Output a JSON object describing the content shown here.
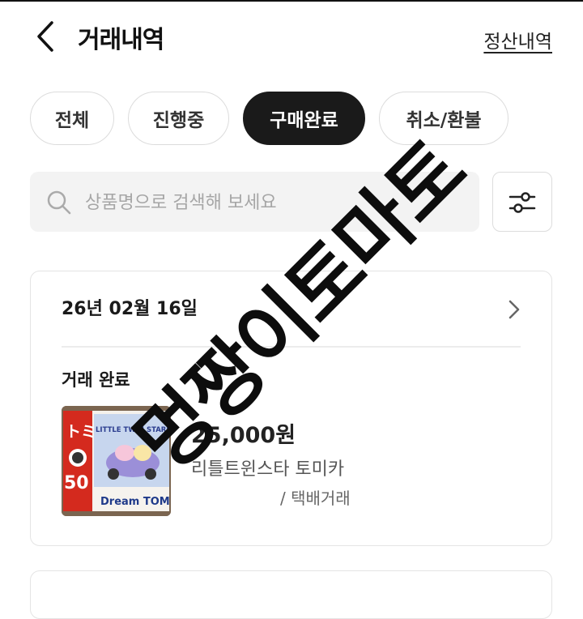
{
  "header": {
    "title": "거래내역",
    "settlement_link": "정산내역"
  },
  "tabs": [
    {
      "label": "전체",
      "selected": false
    },
    {
      "label": "진행중",
      "selected": false
    },
    {
      "label": "구매완료",
      "selected": true
    },
    {
      "label": "취소/환불",
      "selected": false
    }
  ],
  "search": {
    "placeholder": "상품명으로 검색해 보세요",
    "value": ""
  },
  "orders": [
    {
      "date": "26년 02월 16일",
      "status": "거래 완료",
      "price": "25,000원",
      "product_name": "리틀트윈스타 토미카",
      "trade_type": "/ 택배거래",
      "thumbnail": {
        "brand_mark": "トミカ",
        "caption": "Dream TOMICA",
        "product_text": "LITTLE TWIN STARS",
        "number": "50"
      }
    }
  ],
  "watermark": "멍짱이토마토",
  "colors": {
    "selected_tab_bg": "#1a1a1a",
    "search_bg": "#f3f3f3",
    "border": "#dcdcdc"
  },
  "icons": [
    "back-arrow-icon",
    "search-icon",
    "filter-icon",
    "chevron-right-icon"
  ]
}
